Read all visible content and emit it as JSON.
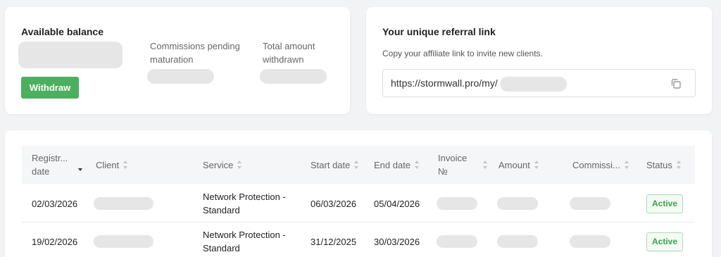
{
  "balance": {
    "title": "Available balance",
    "withdraw_label": "Withdraw",
    "pending_label": "Commissions pending maturation",
    "withdrawn_label": "Total amount withdrawn"
  },
  "referral": {
    "title": "Your unique referral link",
    "description": "Copy your affiliate link to invite new clients.",
    "url_prefix": "https://stormwall.pro/my/"
  },
  "table": {
    "columns": [
      "Registr... date",
      "Client",
      "Service",
      "Start date",
      "End date",
      "Invoice №",
      "Amount",
      "Commissi...",
      "Status"
    ],
    "rows": [
      {
        "reg_date": "02/03/2026",
        "service": "Network Protection - Standard",
        "start_date": "06/03/2026",
        "end_date": "05/04/2026",
        "status": "Active"
      },
      {
        "reg_date": "19/02/2026",
        "service": "Network Protection - Standard",
        "start_date": "31/12/2025",
        "end_date": "30/03/2026",
        "status": "Active"
      }
    ]
  },
  "colors": {
    "accent_green": "#4caf5f",
    "status_active": "#3ba24c",
    "background": "#f2f3f5"
  }
}
